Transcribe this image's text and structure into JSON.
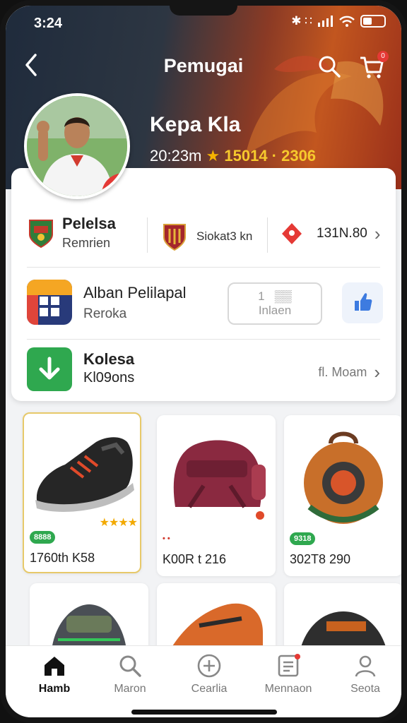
{
  "status": {
    "time": "3:24",
    "signal_text": "✱ ∷",
    "accent": "#e53935"
  },
  "nav": {
    "title": "Pemugai",
    "back_icon": "chevron-left-icon",
    "cart_badge": "0"
  },
  "profile": {
    "name": "Kepa Kla",
    "time": "20:23m",
    "points": "15014 · 2306"
  },
  "club": {
    "name": "Pelelsa",
    "sub": "Remrien"
  },
  "middle_item": {
    "label": "Siokat3 kn"
  },
  "right_item": {
    "label": "131N.80"
  },
  "album": {
    "title": "Alban Pelilapal",
    "sub": "Reroka",
    "button_line1": "1   ▒▒",
    "button_line2": "Inlaen"
  },
  "download": {
    "title": "Kolesa",
    "sub": "Kl09ons",
    "more_label": "fl. Moam"
  },
  "products": [
    {
      "badge": "8888",
      "price": "1760th K58",
      "stars": "★★★★"
    },
    {
      "badge": "• •",
      "price": "K00R t 216"
    },
    {
      "badge": "9318",
      "price": "302T8 290"
    }
  ],
  "tabs": [
    {
      "label": "Hamb",
      "icon": "home-icon"
    },
    {
      "label": "Maron",
      "icon": "search-icon"
    },
    {
      "label": "Cearlia",
      "icon": "plus-circle-icon"
    },
    {
      "label": "Mennaon",
      "icon": "list-icon"
    },
    {
      "label": "Seota",
      "icon": "user-icon"
    }
  ]
}
